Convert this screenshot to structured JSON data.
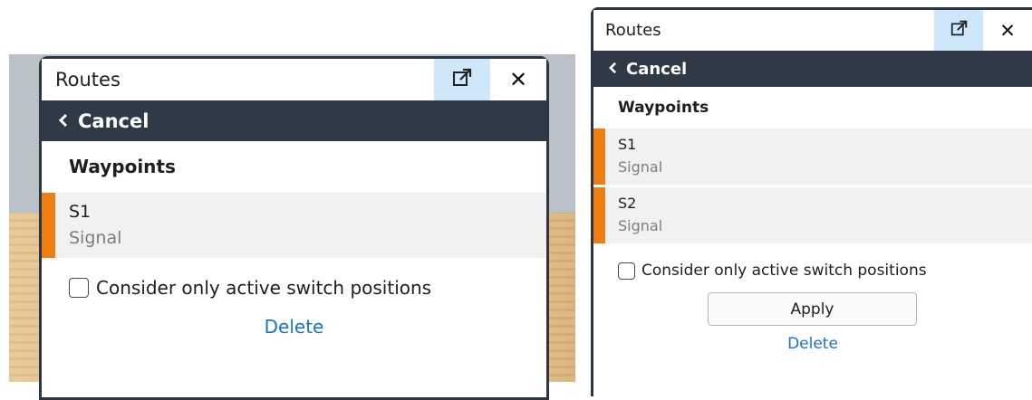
{
  "left_panel": {
    "title": "Routes",
    "popout_icon": "popout-icon",
    "close_icon": "close-icon",
    "close_glyph": "✕",
    "cancel_label": "Cancel",
    "section_heading": "Waypoints",
    "waypoints": [
      {
        "name": "S1",
        "kind": "Signal"
      }
    ],
    "checkbox_label": "Consider only active switch positions",
    "checkbox_checked": false,
    "delete_label": "Delete"
  },
  "right_panel": {
    "title": "Routes",
    "popout_icon": "popout-icon",
    "close_icon": "close-icon",
    "close_glyph": "✕",
    "cancel_label": "Cancel",
    "section_heading": "Waypoints",
    "waypoints": [
      {
        "name": "S1",
        "kind": "Signal"
      },
      {
        "name": "S2",
        "kind": "Signal"
      }
    ],
    "checkbox_label": "Consider only active switch positions",
    "checkbox_checked": false,
    "apply_label": "Apply",
    "delete_label": "Delete"
  },
  "colors": {
    "accent_marker": "#f07d10",
    "cancel_bar": "#2f3a46",
    "link": "#1a73c8",
    "popout_bg": "#cfe7fb"
  }
}
